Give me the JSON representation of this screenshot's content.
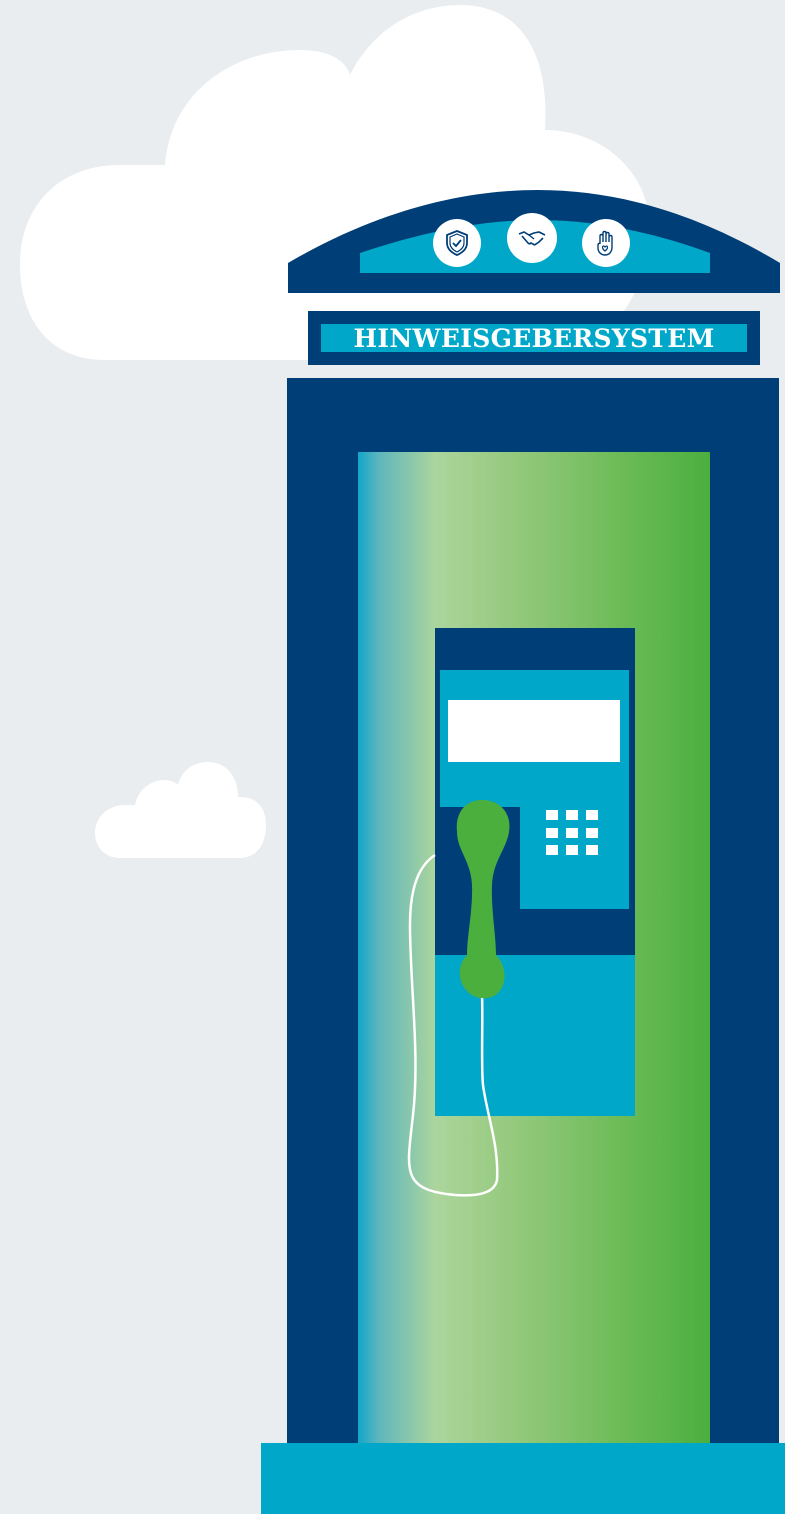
{
  "sign": {
    "title": "HINWEISGEBERSYSTEM"
  },
  "roof_icons": [
    {
      "name": "shield-check-icon"
    },
    {
      "name": "handshake-icon"
    },
    {
      "name": "hand-heart-icon"
    }
  ],
  "colors": {
    "background": "#e9edf0",
    "navy": "#003e78",
    "cyan": "#00a7c8",
    "green": "#4baf3e",
    "cloud": "#ffffff"
  }
}
